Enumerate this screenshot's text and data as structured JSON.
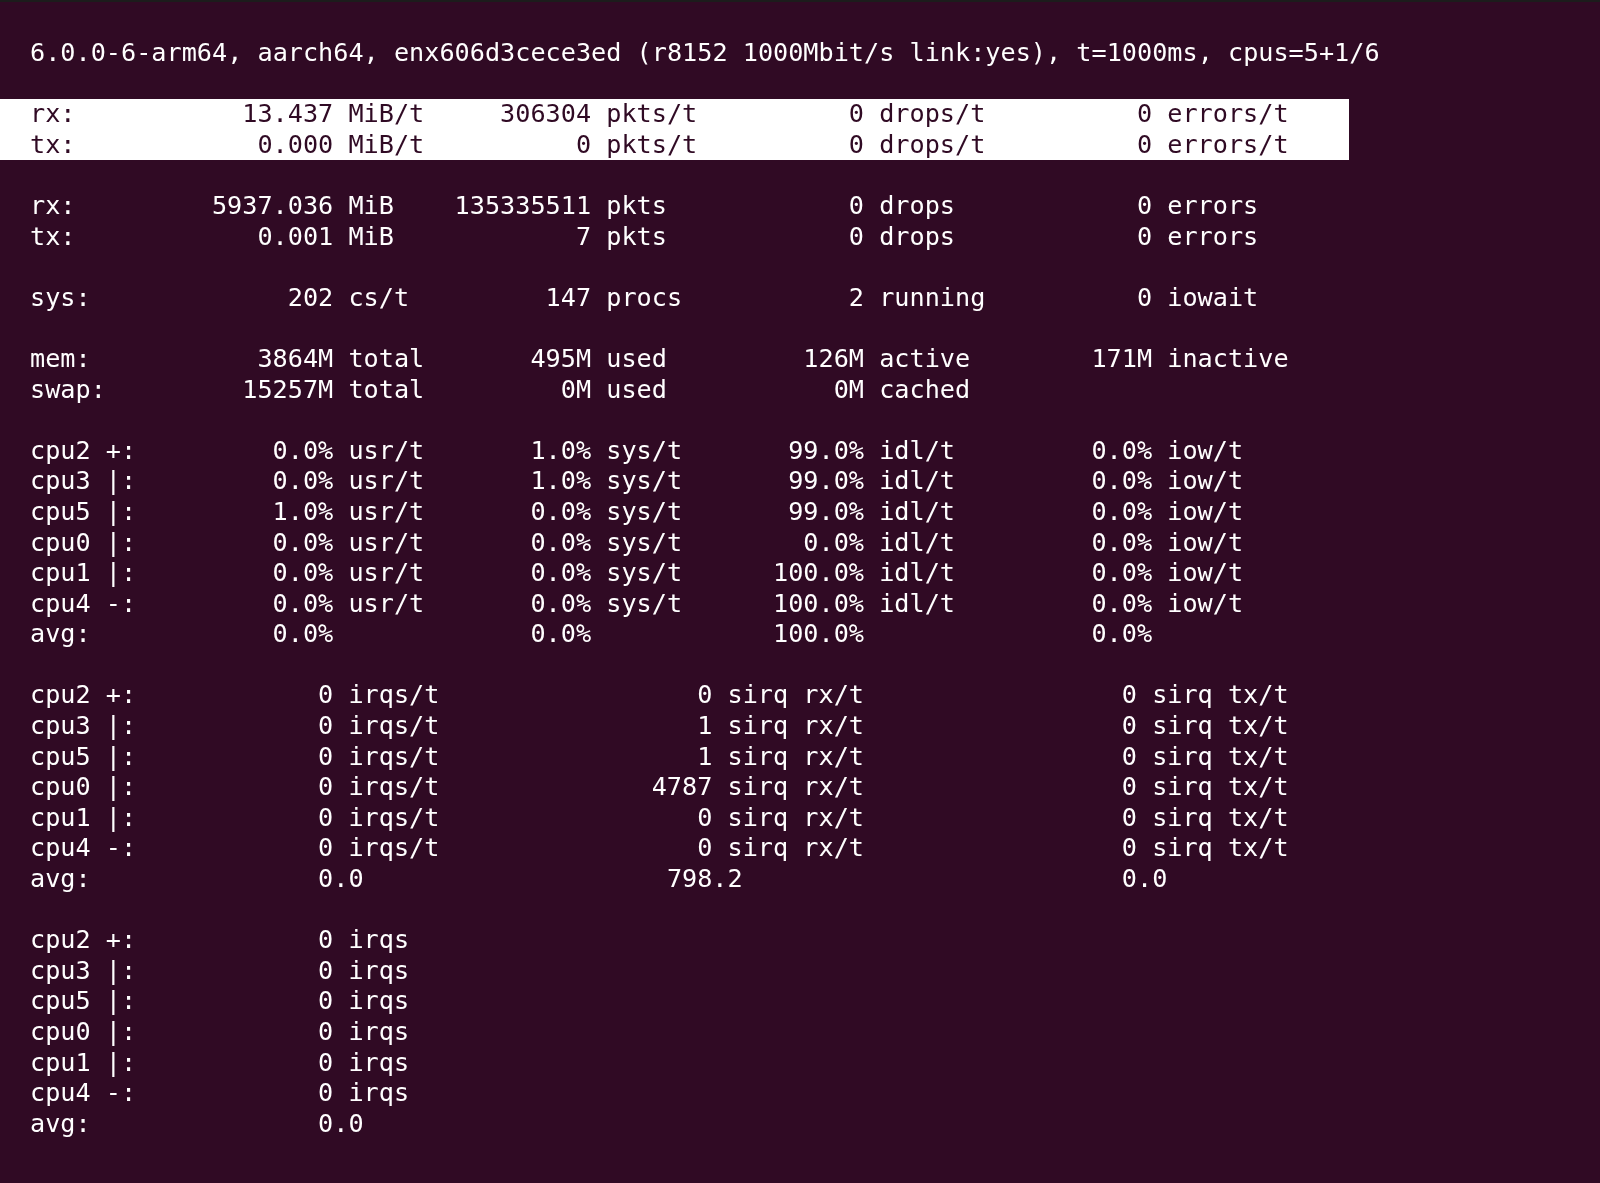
{
  "header": "6.0.0-6-arm64, aarch64, enx606d3cece3ed (r8152 1000Mbit/s link:yes), t=1000ms, cpus=5+1/6",
  "sections": [
    {
      "kind": "net",
      "rows": [
        {
          "label": "rx:",
          "highlighted": true,
          "cells": [
            {
              "value": "13.437",
              "unit": "MiB/t"
            },
            {
              "value": "306304",
              "unit": "pkts/t"
            },
            {
              "value": "0",
              "unit": "drops/t"
            },
            {
              "value": "0",
              "unit": "errors/t"
            }
          ]
        },
        {
          "label": "tx:",
          "highlighted": true,
          "cells": [
            {
              "value": "0.000",
              "unit": "MiB/t"
            },
            {
              "value": "0",
              "unit": "pkts/t"
            },
            {
              "value": "0",
              "unit": "drops/t"
            },
            {
              "value": "0",
              "unit": "errors/t"
            }
          ]
        }
      ]
    },
    {
      "kind": "net",
      "rows": [
        {
          "label": "rx:",
          "highlighted": false,
          "cells": [
            {
              "value": "5937.036",
              "unit": "MiB"
            },
            {
              "value": "135335511",
              "unit": "pkts"
            },
            {
              "value": "0",
              "unit": "drops"
            },
            {
              "value": "0",
              "unit": "errors"
            }
          ]
        },
        {
          "label": "tx:",
          "highlighted": false,
          "cells": [
            {
              "value": "0.001",
              "unit": "MiB"
            },
            {
              "value": "7",
              "unit": "pkts"
            },
            {
              "value": "0",
              "unit": "drops"
            },
            {
              "value": "0",
              "unit": "errors"
            }
          ]
        }
      ]
    },
    {
      "kind": "net",
      "rows": [
        {
          "label": "sys:",
          "cells": [
            {
              "value": "202",
              "unit": "cs/t"
            },
            {
              "value": "147",
              "unit": "procs"
            },
            {
              "value": "2",
              "unit": "running"
            },
            {
              "value": "0",
              "unit": "iowait"
            }
          ]
        }
      ]
    },
    {
      "kind": "net",
      "rows": [
        {
          "label": "mem:",
          "cells": [
            {
              "value": "3864M",
              "unit": "total"
            },
            {
              "value": "495M",
              "unit": "used"
            },
            {
              "value": "126M",
              "unit": "active"
            },
            {
              "value": "171M",
              "unit": "inactive"
            }
          ]
        },
        {
          "label": "swap:",
          "cells": [
            {
              "value": "15257M",
              "unit": "total"
            },
            {
              "value": "0M",
              "unit": "used"
            },
            {
              "value": "0M",
              "unit": "cached"
            }
          ]
        }
      ]
    },
    {
      "kind": "net",
      "rows": [
        {
          "label": "cpu2 +:",
          "cells": [
            {
              "value": "0.0%",
              "unit": "usr/t"
            },
            {
              "value": "1.0%",
              "unit": "sys/t"
            },
            {
              "value": "99.0%",
              "unit": "idl/t"
            },
            {
              "value": "0.0%",
              "unit": "iow/t"
            }
          ]
        },
        {
          "label": "cpu3 |:",
          "cells": [
            {
              "value": "0.0%",
              "unit": "usr/t"
            },
            {
              "value": "1.0%",
              "unit": "sys/t"
            },
            {
              "value": "99.0%",
              "unit": "idl/t"
            },
            {
              "value": "0.0%",
              "unit": "iow/t"
            }
          ]
        },
        {
          "label": "cpu5 |:",
          "cells": [
            {
              "value": "1.0%",
              "unit": "usr/t"
            },
            {
              "value": "0.0%",
              "unit": "sys/t"
            },
            {
              "value": "99.0%",
              "unit": "idl/t"
            },
            {
              "value": "0.0%",
              "unit": "iow/t"
            }
          ]
        },
        {
          "label": "cpu0 |:",
          "cells": [
            {
              "value": "0.0%",
              "unit": "usr/t"
            },
            {
              "value": "0.0%",
              "unit": "sys/t"
            },
            {
              "value": "0.0%",
              "unit": "idl/t"
            },
            {
              "value": "0.0%",
              "unit": "iow/t"
            }
          ]
        },
        {
          "label": "cpu1 |:",
          "cells": [
            {
              "value": "0.0%",
              "unit": "usr/t"
            },
            {
              "value": "0.0%",
              "unit": "sys/t"
            },
            {
              "value": "100.0%",
              "unit": "idl/t"
            },
            {
              "value": "0.0%",
              "unit": "iow/t"
            }
          ]
        },
        {
          "label": "cpu4 -:",
          "cells": [
            {
              "value": "0.0%",
              "unit": "usr/t"
            },
            {
              "value": "0.0%",
              "unit": "sys/t"
            },
            {
              "value": "100.0%",
              "unit": "idl/t"
            },
            {
              "value": "0.0%",
              "unit": "iow/t"
            }
          ]
        },
        {
          "label": "avg:",
          "cells": [
            {
              "value": "0.0%"
            },
            {
              "value": "0.0%"
            },
            {
              "value": "100.0%"
            },
            {
              "value": "0.0%"
            }
          ]
        }
      ]
    },
    {
      "kind": "irq",
      "rows": [
        {
          "label": "cpu2 +:",
          "kind": "value",
          "cells": [
            {
              "value": "0",
              "unit": "irqs/t"
            },
            {
              "value": "0",
              "unit": "sirq rx/t"
            },
            {
              "value": "0",
              "unit": "sirq tx/t"
            }
          ]
        },
        {
          "label": "cpu3 |:",
          "kind": "value",
          "cells": [
            {
              "value": "0",
              "unit": "irqs/t"
            },
            {
              "value": "1",
              "unit": "sirq rx/t"
            },
            {
              "value": "0",
              "unit": "sirq tx/t"
            }
          ]
        },
        {
          "label": "cpu5 |:",
          "kind": "value",
          "cells": [
            {
              "value": "0",
              "unit": "irqs/t"
            },
            {
              "value": "1",
              "unit": "sirq rx/t"
            },
            {
              "value": "0",
              "unit": "sirq tx/t"
            }
          ]
        },
        {
          "label": "cpu0 |:",
          "kind": "value",
          "cells": [
            {
              "value": "0",
              "unit": "irqs/t"
            },
            {
              "value": "4787",
              "unit": "sirq rx/t"
            },
            {
              "value": "0",
              "unit": "sirq tx/t"
            }
          ]
        },
        {
          "label": "cpu1 |:",
          "kind": "value",
          "cells": [
            {
              "value": "0",
              "unit": "irqs/t"
            },
            {
              "value": "0",
              "unit": "sirq rx/t"
            },
            {
              "value": "0",
              "unit": "sirq tx/t"
            }
          ]
        },
        {
          "label": "cpu4 -:",
          "kind": "value",
          "cells": [
            {
              "value": "0",
              "unit": "irqs/t"
            },
            {
              "value": "0",
              "unit": "sirq rx/t"
            },
            {
              "value": "0",
              "unit": "sirq tx/t"
            }
          ]
        },
        {
          "label": "avg:",
          "kind": "avg",
          "cells": [
            {
              "value": "0.0"
            },
            {
              "value": "798.2"
            },
            {
              "value": "0.0"
            }
          ]
        }
      ]
    },
    {
      "kind": "irq",
      "rows": [
        {
          "label": "cpu2 +:",
          "kind": "value",
          "cells": [
            {
              "value": "0",
              "unit": "irqs"
            }
          ]
        },
        {
          "label": "cpu3 |:",
          "kind": "value",
          "cells": [
            {
              "value": "0",
              "unit": "irqs"
            }
          ]
        },
        {
          "label": "cpu5 |:",
          "kind": "value",
          "cells": [
            {
              "value": "0",
              "unit": "irqs"
            }
          ]
        },
        {
          "label": "cpu0 |:",
          "kind": "value",
          "cells": [
            {
              "value": "0",
              "unit": "irqs"
            }
          ]
        },
        {
          "label": "cpu1 |:",
          "kind": "value",
          "cells": [
            {
              "value": "0",
              "unit": "irqs"
            }
          ]
        },
        {
          "label": "cpu4 -:",
          "kind": "value",
          "cells": [
            {
              "value": "0",
              "unit": "irqs"
            }
          ]
        },
        {
          "label": "avg:",
          "kind": "avg",
          "cells": [
            {
              "value": "0.0"
            }
          ]
        }
      ]
    }
  ]
}
